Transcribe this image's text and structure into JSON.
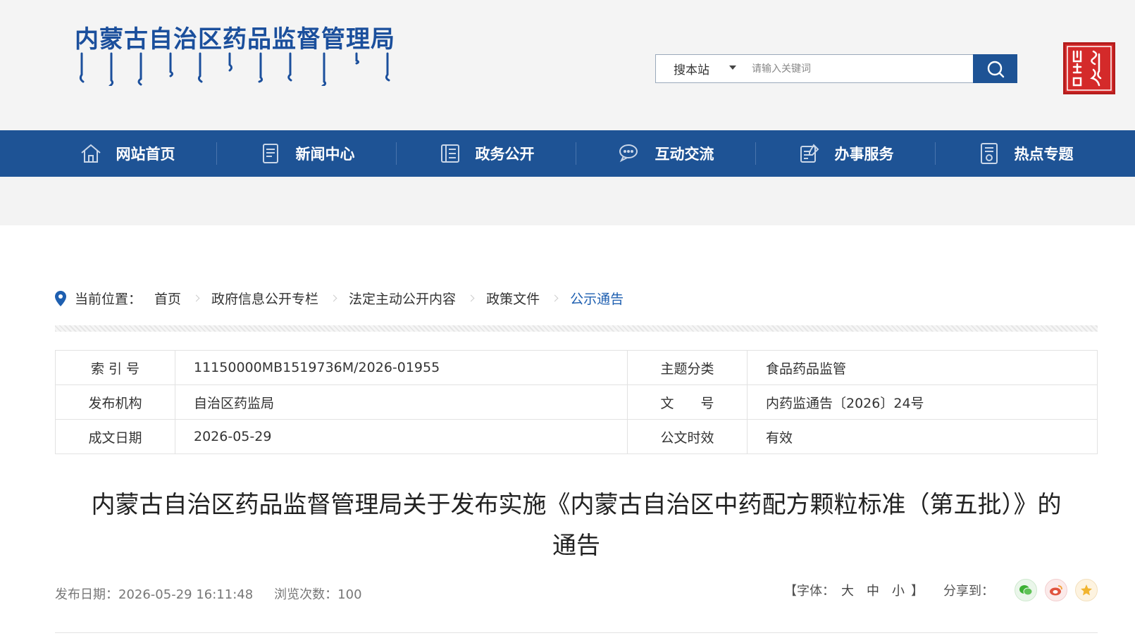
{
  "header": {
    "logo_text": "内蒙古自治区药品监督管理局",
    "search": {
      "scope_label": "搜本站",
      "placeholder": "请输入关键词"
    }
  },
  "nav": {
    "items": [
      {
        "label": "网站首页",
        "icon": "home-icon"
      },
      {
        "label": "新闻中心",
        "icon": "news-icon"
      },
      {
        "label": "政务公开",
        "icon": "government-affairs-icon"
      },
      {
        "label": "互动交流",
        "icon": "chat-icon"
      },
      {
        "label": "办事服务",
        "icon": "service-icon"
      },
      {
        "label": "热点专题",
        "icon": "topic-icon"
      }
    ]
  },
  "breadcrumb": {
    "label": "当前位置：",
    "items": [
      "首页",
      "政府信息公开专栏",
      "法定主动公开内容",
      "政策文件",
      "公示通告"
    ]
  },
  "meta": {
    "rows": [
      {
        "k1": "索 引 号",
        "v1": "11150000MB1519736M/2026-01955",
        "k2": "主题分类",
        "v2": "食品药品监管"
      },
      {
        "k1": "发布机构",
        "v1": "自治区药监局",
        "k2": "文　　号",
        "v2": "内药监通告〔2026〕24号"
      },
      {
        "k1": "成文日期",
        "v1": "2026-05-29",
        "k2": "公文时效",
        "v2": "有效"
      }
    ]
  },
  "article": {
    "title_line1": "内蒙古自治区药品监督管理局关于发布实施《内蒙古自治区中药配方颗粒标准（第五批）》的",
    "title_line2": "通告",
    "publish_date": "发布日期：2026-05-29 16:11:48",
    "views": "浏览次数：100",
    "font_label_open": "【字体：",
    "font_large": "大",
    "font_medium": "中",
    "font_small": "小",
    "font_label_close": "】",
    "share_label": "分享到："
  },
  "colors": {
    "brand_blue": "#1e5395",
    "seal_red": "#d42a2a",
    "link_blue": "#1e5fb0"
  }
}
